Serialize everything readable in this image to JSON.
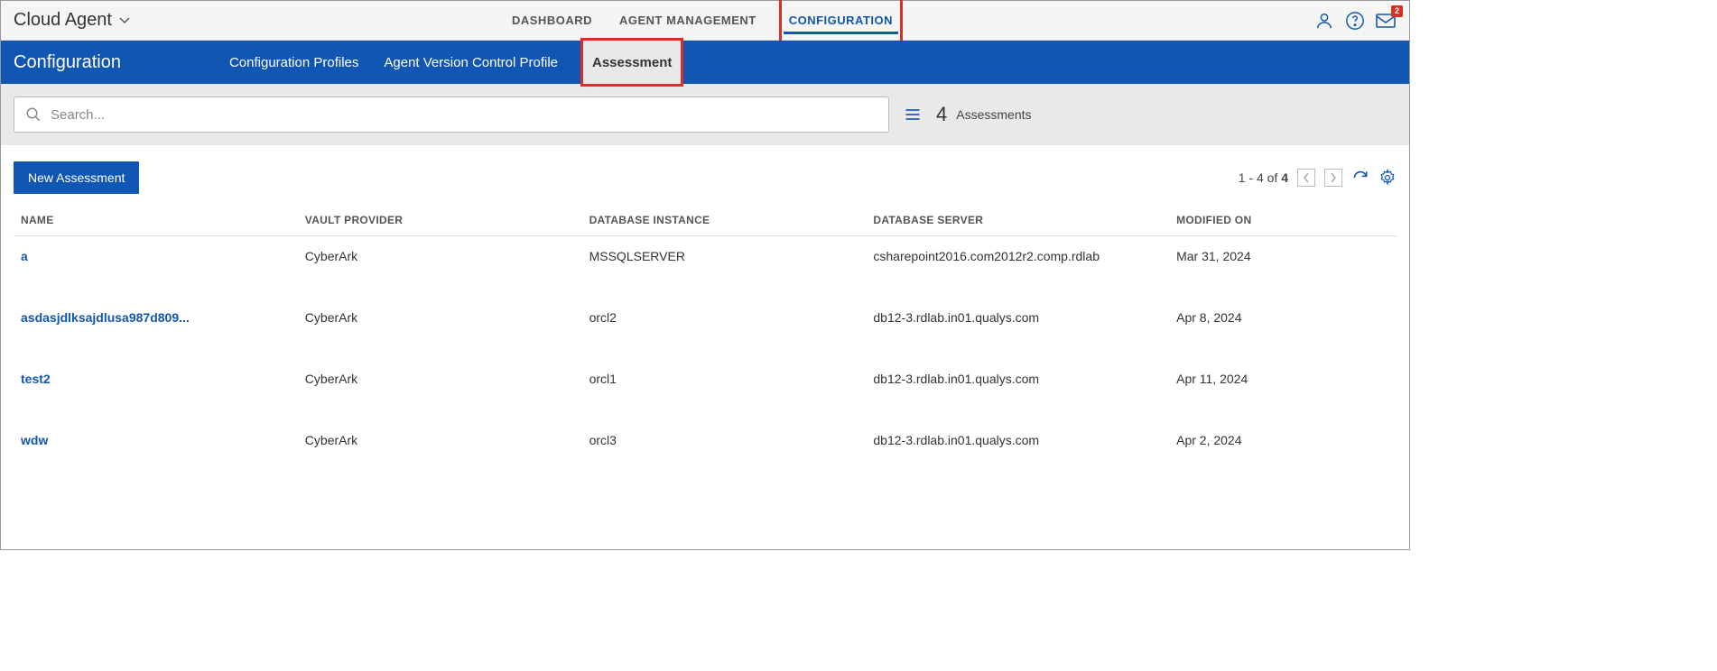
{
  "app": {
    "title": "Cloud Agent"
  },
  "topnav": {
    "dashboard": "DASHBOARD",
    "agent_mgmt": "AGENT MANAGEMENT",
    "configuration": "CONFIGURATION"
  },
  "mail_badge": "2",
  "subhead": {
    "title": "Configuration"
  },
  "subtabs": {
    "profiles": "Configuration Profiles",
    "version": "Agent Version Control Profile",
    "assessment": "Assessment"
  },
  "search": {
    "placeholder": "Search..."
  },
  "count": {
    "num": "4",
    "label": "Assessments"
  },
  "actions": {
    "new": "New Assessment"
  },
  "pager": {
    "range": "1 - 4 of ",
    "total": "4"
  },
  "columns": {
    "name": "NAME",
    "vault": "VAULT PROVIDER",
    "dbinstance": "DATABASE INSTANCE",
    "dbserver": "DATABASE SERVER",
    "modified": "MODIFIED ON"
  },
  "rows": [
    {
      "name": "a",
      "vault": "CyberArk",
      "dbinstance": "MSSQLSERVER",
      "dbserver": "csharepoint2016.com2012r2.comp.rdlab",
      "modified": "Mar 31, 2024"
    },
    {
      "name": "asdasjdlksajdlusa987d809...",
      "vault": "CyberArk",
      "dbinstance": "orcl2",
      "dbserver": "db12-3.rdlab.in01.qualys.com",
      "modified": "Apr 8, 2024"
    },
    {
      "name": "test2",
      "vault": "CyberArk",
      "dbinstance": "orcl1",
      "dbserver": "db12-3.rdlab.in01.qualys.com",
      "modified": "Apr 11, 2024"
    },
    {
      "name": "wdw",
      "vault": "CyberArk",
      "dbinstance": "orcl3",
      "dbserver": "db12-3.rdlab.in01.qualys.com",
      "modified": "Apr 2, 2024"
    }
  ]
}
